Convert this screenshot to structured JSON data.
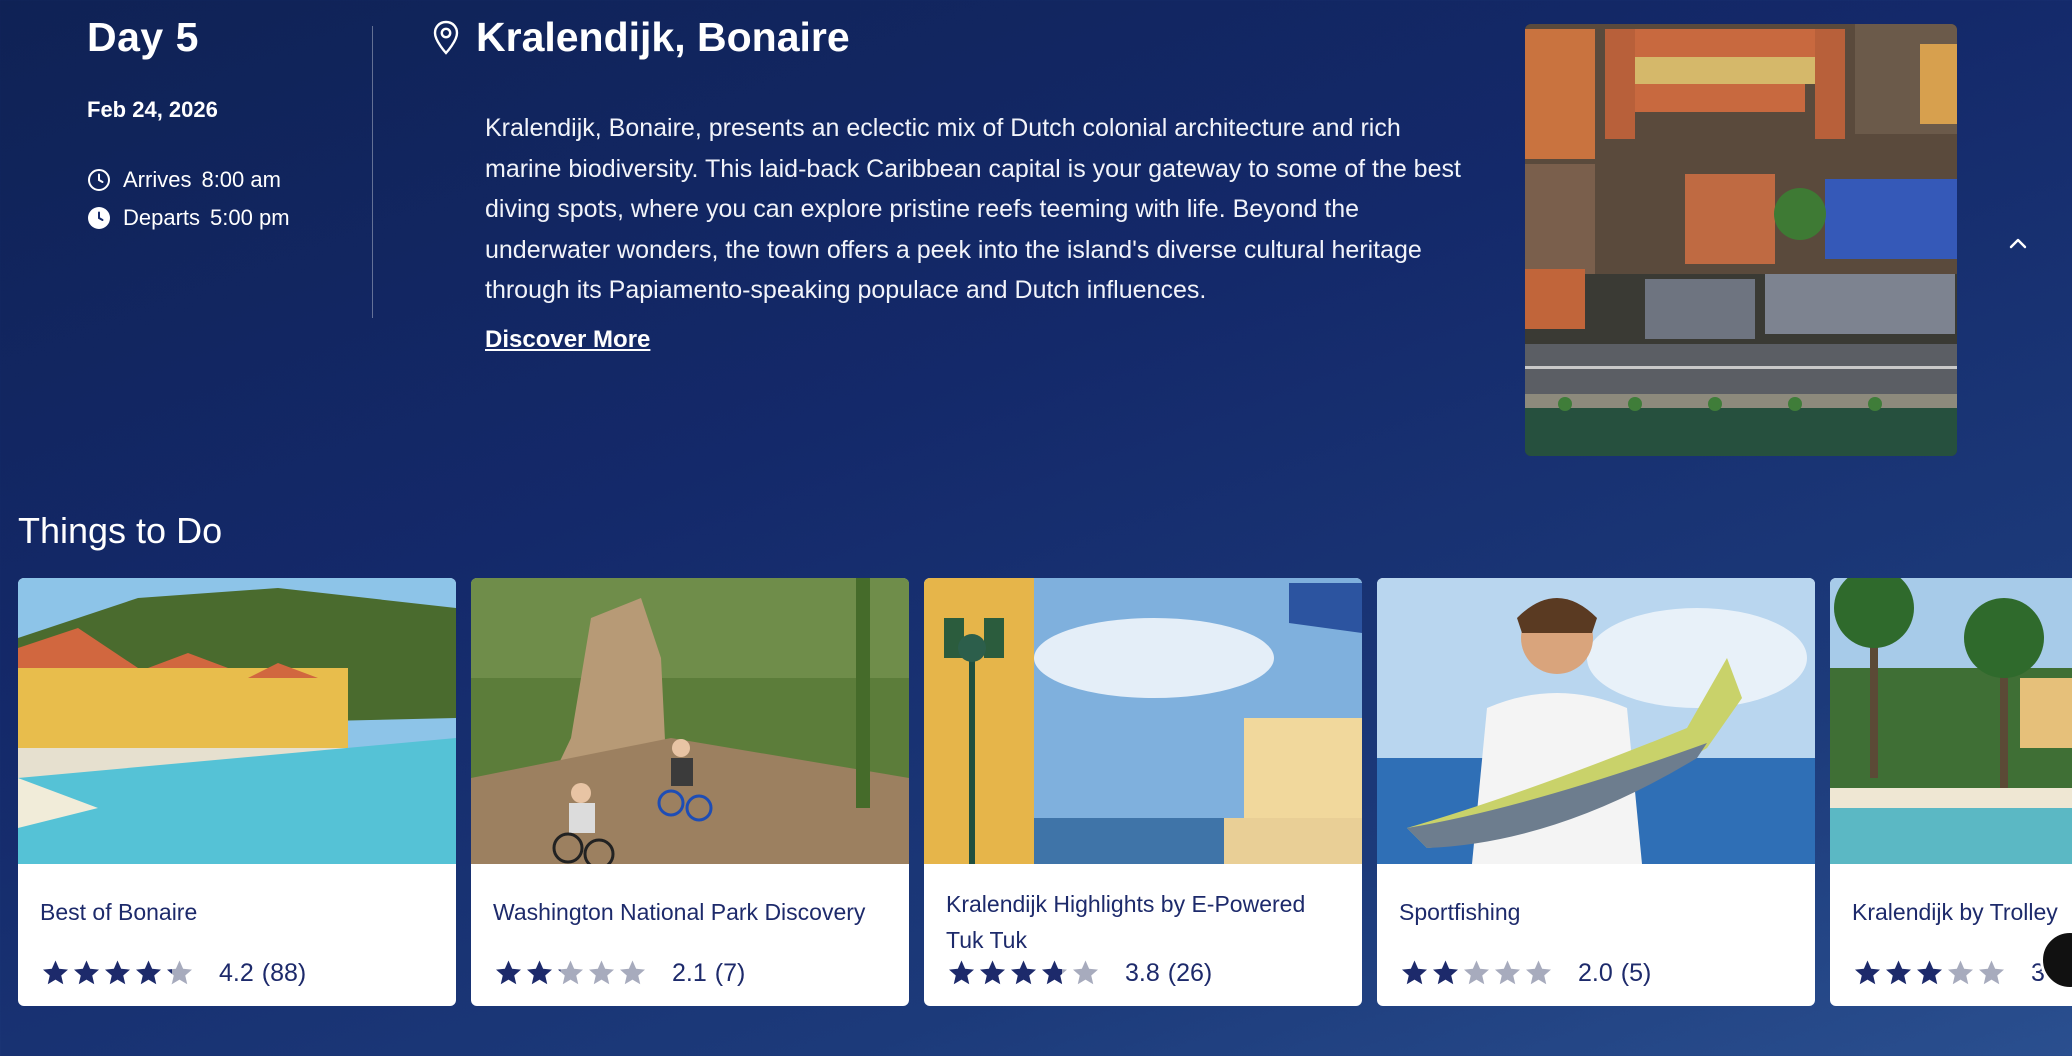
{
  "day": {
    "title": "Day 5",
    "date": "Feb 24, 2026",
    "arrives_label": "Arrives",
    "arrives_time": "8:00 am",
    "departs_label": "Departs",
    "departs_time": "5:00 pm"
  },
  "port": {
    "name": "Kralendijk, Bonaire",
    "description": "Kralendijk, Bonaire, presents an eclectic mix of Dutch colonial architecture and rich marine biodiversity. This laid-back Caribbean capital is your gateway to some of the best diving spots, where you can explore pristine reefs teeming with life. Beyond the underwater wonders, the town offers a peek into the island's diverse cultural heritage through its Papiamento-speaking populace and Dutch influences.",
    "discover_label": "Discover More",
    "icon": "location-pin-icon"
  },
  "things_to_do": {
    "title": "Things to Do",
    "cards": [
      {
        "name": "Best of Bonaire",
        "rating": "4.2",
        "reviews": "(88)",
        "stars": 4.2
      },
      {
        "name": "Washington National Park Discovery",
        "rating": "2.1",
        "reviews": "(7)",
        "stars": 2.1
      },
      {
        "name": "Kralendijk Highlights by E-Powered Tuk Tuk",
        "rating": "3.8",
        "reviews": "(26)",
        "stars": 3.8
      },
      {
        "name": "Sportfishing",
        "rating": "2.0",
        "reviews": "(5)",
        "stars": 2.0
      },
      {
        "name": "Kralendijk by Trolley",
        "rating": "3",
        "reviews": "",
        "stars": 3.0
      }
    ]
  },
  "colors": {
    "background": "#14296a",
    "star_filled": "#1d2a6b",
    "star_empty": "#a7abbd",
    "card_text": "#1d2a6b"
  }
}
